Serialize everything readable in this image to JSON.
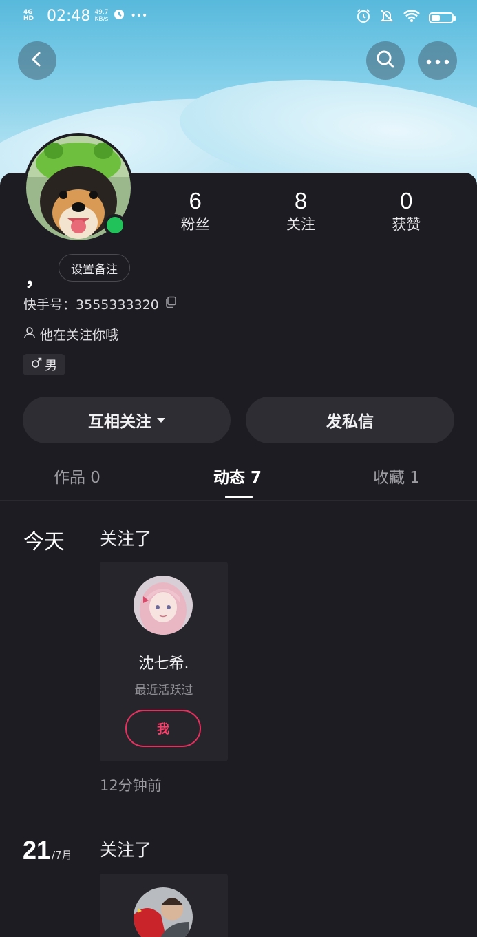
{
  "status_bar": {
    "network": "4G HD",
    "time": "02:48",
    "speed_value": "49.7",
    "speed_unit": "KB/s",
    "more": "•••"
  },
  "profile": {
    "nickname": "，",
    "remark_button": "设置备注",
    "id_label": "快手号：",
    "id_value": "3555333320",
    "follows_you": "他在关注你哦",
    "gender": "男",
    "online": true
  },
  "stats": [
    {
      "value": "6",
      "label": "粉丝"
    },
    {
      "value": "8",
      "label": "关注"
    },
    {
      "value": "0",
      "label": "获赞"
    }
  ],
  "actions": {
    "mutual_follow": "互相关注",
    "send_message": "发私信"
  },
  "tabs": [
    {
      "label": "作品 0",
      "active": false
    },
    {
      "label": "动态 7",
      "active": true
    },
    {
      "label": "收藏 1",
      "active": false
    }
  ],
  "feed": [
    {
      "date": "今天",
      "action": "关注了",
      "card": {
        "name": "沈七希.",
        "subtitle": "最近活跃过",
        "button": "我"
      },
      "time_ago": "12分钟前"
    },
    {
      "date_day": "21",
      "date_month": "/7月",
      "action": "关注了"
    }
  ],
  "colors": {
    "background": "#1d1c22",
    "online": "#22c25a",
    "accent_pink": "#e6315f"
  },
  "icons": {
    "back": "back-icon",
    "search": "search-icon",
    "more": "more-icon",
    "copy": "copy-icon",
    "person": "person-icon",
    "male": "male-icon"
  }
}
